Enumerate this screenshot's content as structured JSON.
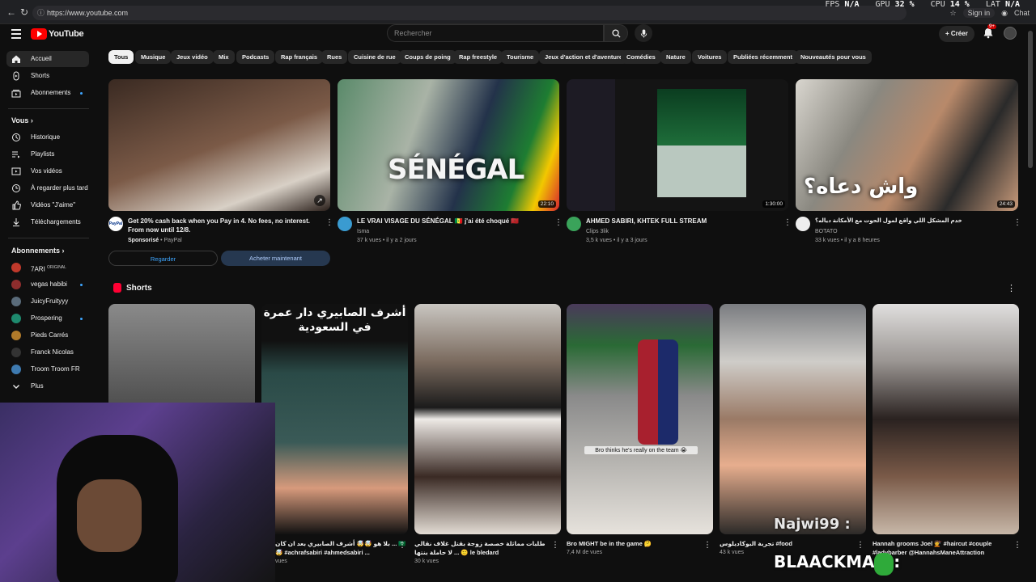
{
  "browser": {
    "url": "https://www.youtube.com",
    "perf": {
      "fps_label": "FPS",
      "fps": "N/A",
      "gpu_label": "GPU",
      "gpu": "32 %",
      "cpu_label": "CPU",
      "cpu": "14 %",
      "lat_label": "LAT",
      "lat": "N/A"
    },
    "signin": "Sign in",
    "chat": "Chat"
  },
  "header": {
    "logo": "YouTube",
    "search_placeholder": "Rechercher",
    "create": "Créer",
    "notifications": "9+"
  },
  "sidebar": {
    "main": [
      {
        "label": "Accueil",
        "icon": "home-icon"
      },
      {
        "label": "Shorts",
        "icon": "shorts-icon"
      },
      {
        "label": "Abonnements",
        "icon": "subscriptions-icon"
      }
    ],
    "you_heading": "Vous",
    "you": [
      {
        "label": "Historique",
        "icon": "history-icon"
      },
      {
        "label": "Playlists",
        "icon": "playlist-icon"
      },
      {
        "label": "Vos vidéos",
        "icon": "your-videos-icon"
      },
      {
        "label": "À regarder plus tard",
        "icon": "watch-later-icon"
      },
      {
        "label": "Vidéos \"J'aime\"",
        "icon": "liked-icon"
      },
      {
        "label": "Téléchargements",
        "icon": "download-icon"
      }
    ],
    "subs_heading": "Abonnements",
    "subs": [
      {
        "label": "7ARI",
        "badge": "ORIGINAL",
        "color": "#c0392b"
      },
      {
        "label": "vegas habibi",
        "color": "#8e2d2d"
      },
      {
        "label": "JuicyFruityyy",
        "color": "#5a6b7a"
      },
      {
        "label": "Prospering",
        "color": "#1e8a6e"
      },
      {
        "label": "Pieds Carrés",
        "color": "#b07a2a"
      },
      {
        "label": "Franck Nicolas",
        "color": "#333333"
      },
      {
        "label": "Troom Troom FR",
        "color": "#3e7ab0"
      }
    ],
    "more": "Plus"
  },
  "chips": [
    "Tous",
    "Musique",
    "Jeux vidéo",
    "Mix",
    "Podcasts",
    "Rap français",
    "Rues",
    "Cuisine de rue",
    "Coups de poing",
    "Rap freestyle",
    "Tourisme",
    "Jeux d'action et d'aventure",
    "Comédies",
    "Nature",
    "Voitures",
    "Publiées récemment",
    "Nouveautés pour vous"
  ],
  "videos": [
    {
      "title": "Get 20% cash back when you Pay in 4. No fees, no interest. From now until 12/8.",
      "sponsored": "Sponsorisé",
      "channel": "PayPal",
      "btn_watch": "Regarder",
      "btn_buy": "Acheter maintenant"
    },
    {
      "title": "LE VRAI VISAGE DU SÉNÉGAL 🇸🇳 j'ai été choqué 🇲🇦",
      "channel": "Isma",
      "meta": "37 k vues • il y a 2 jours",
      "duration": "22:10",
      "overlay": "SÉNÉGAL"
    },
    {
      "title": "AHMED SABIRI, KHTEK FULL STREAM",
      "channel": "Clips 3lik",
      "meta": "3,5 k vues • il y a 3 jours",
      "duration": "1:30:00"
    },
    {
      "title": "خدم المشكل اللي واقع لمول الحوت مع الأمكانة دياله؟",
      "channel": "BOTATO",
      "meta": "33 k vues • il y a 8 heures",
      "duration": "24:43",
      "overlay": "واش دعاه؟"
    }
  ],
  "shorts_heading": "Shorts",
  "shorts": [
    {
      "title": "",
      "meta": ""
    },
    {
      "title": "بلا هو 🤯🤯 أشرف الصابيري بعد ان كان ... 🇸🇦🤯 #achrafsabiri #ahmedsabiri ...",
      "meta": "vues",
      "overlay": "أشرف الصابيري دار عمرة في السعودية"
    },
    {
      "title": "طلبات مماثلة خصصة زوجة بقتل غلاف نقالي لا حاملة بنتها ... 🙂 le bledard",
      "meta": "30 k vues"
    },
    {
      "title": "Bro MIGHT be in the game 🤔",
      "meta": "7,4 M de vues",
      "overlay": "Bro thinks he's really on the team 😭"
    },
    {
      "title": "تجربة البوكاديلوس #food",
      "meta": "43 k vues"
    },
    {
      "title": "Hannah grooms Joel 💇 #haircut #couple #ladybarber @HannahsManeAttraction",
      "meta": ""
    }
  ],
  "stream": {
    "chat1": "Najwi99 :",
    "chat2": "BLAACKMAN :"
  }
}
